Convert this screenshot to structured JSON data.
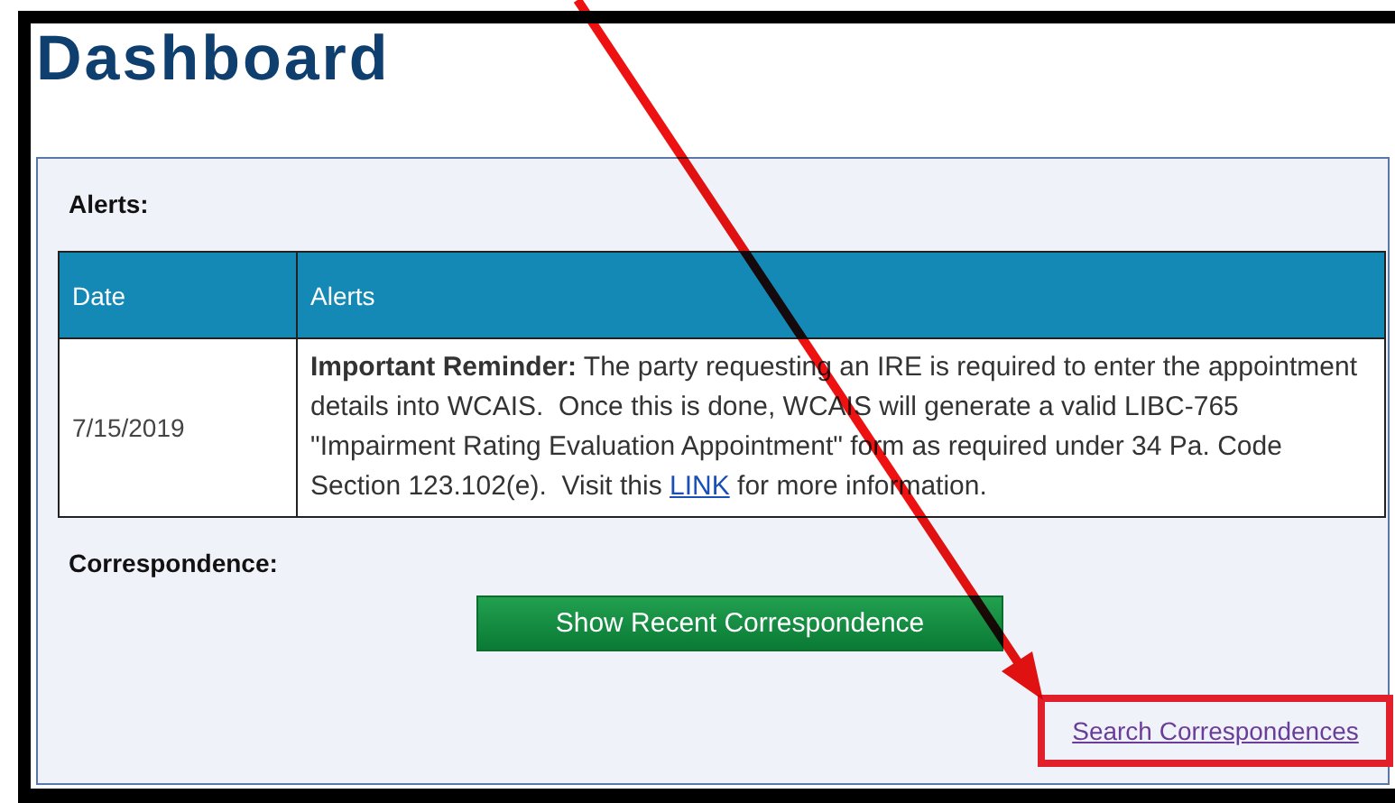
{
  "page": {
    "title": "Dashboard"
  },
  "alerts": {
    "label": "Alerts:",
    "columns": [
      "Date",
      "Alerts"
    ],
    "rows": [
      {
        "date": "7/15/2019",
        "message_before": "**Important Reminder:** The party requesting an IRE is required to enter the appointment details into WCAIS.  Once this is done, WCAIS will generate a valid LIBC-765 \"Impairment Rating Evaluation Appointment\" form as required under 34 Pa. Code Section 123.102(e).  Visit this ",
        "link": "LINK",
        "message_after": " for more information."
      }
    ]
  },
  "correspondence": {
    "label": "Correspondence:",
    "button": "Show Recent Correspondence",
    "search_link": "Search Correspondences",
    "highlighted": true
  },
  "annotations": [
    {
      "kind": "arrow"
    }
  ]
}
